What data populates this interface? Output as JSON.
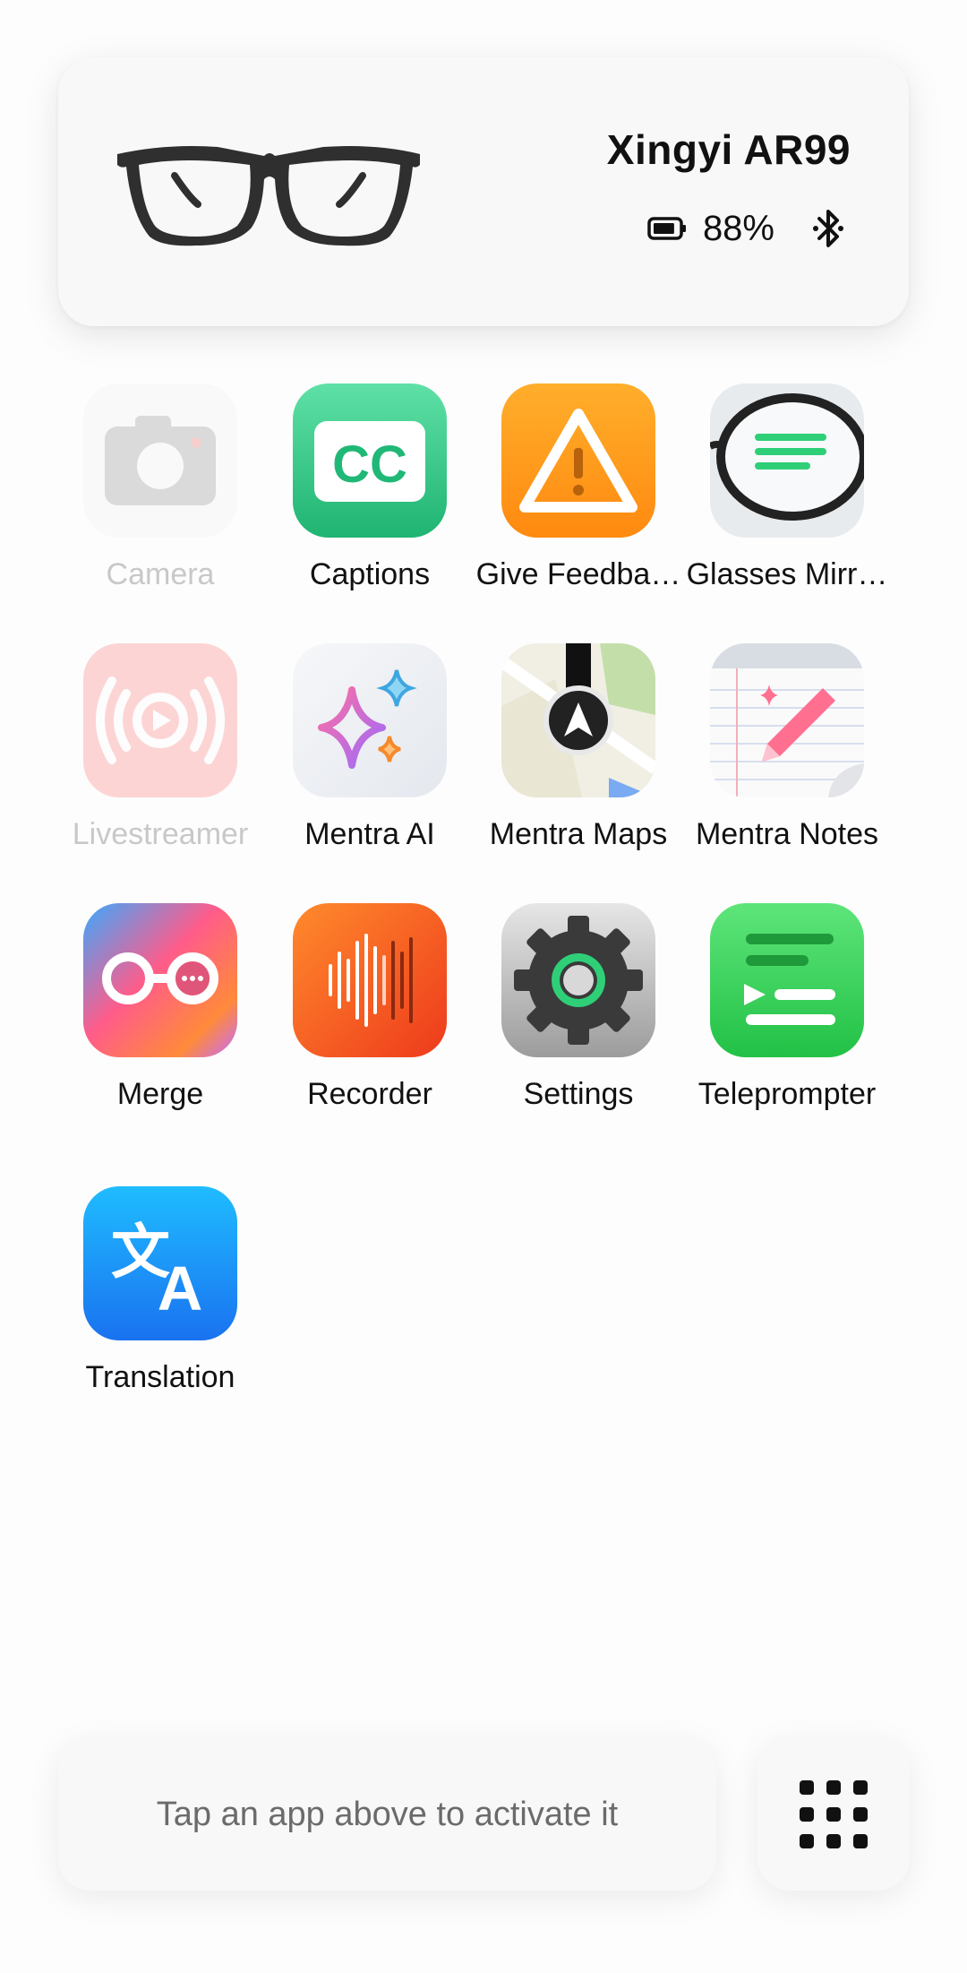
{
  "device": {
    "name": "Xingyi AR99",
    "battery": "88%",
    "battery_level": 0.88,
    "connection": "bluetooth-icon"
  },
  "apps": [
    {
      "label": "Camera",
      "icon": "camera-icon",
      "enabled": false
    },
    {
      "label": "Captions",
      "icon": "captions-icon",
      "enabled": true
    },
    {
      "label": "Give Feedba…",
      "icon": "warning-icon",
      "enabled": true
    },
    {
      "label": "Glasses Mirr…",
      "icon": "glasses-mirror-icon",
      "enabled": true
    },
    {
      "label": "Livestreamer",
      "icon": "livestream-icon",
      "enabled": false
    },
    {
      "label": "Mentra AI",
      "icon": "sparkles-icon",
      "enabled": true
    },
    {
      "label": "Mentra Maps",
      "icon": "map-navigation-icon",
      "enabled": true
    },
    {
      "label": "Mentra Notes",
      "icon": "notes-pencil-icon",
      "enabled": true
    },
    {
      "label": "Merge",
      "icon": "merge-glasses-chat-icon",
      "enabled": true
    },
    {
      "label": "Recorder",
      "icon": "waveform-icon",
      "enabled": true
    },
    {
      "label": "Settings",
      "icon": "gear-icon",
      "enabled": true
    },
    {
      "label": "Teleprompter",
      "icon": "teleprompter-icon",
      "enabled": true
    },
    {
      "label": "Translation",
      "icon": "translate-icon",
      "enabled": true
    }
  ],
  "bottom": {
    "hint": "Tap an app above to activate it",
    "grid_button_icon": "app-grid-icon"
  }
}
